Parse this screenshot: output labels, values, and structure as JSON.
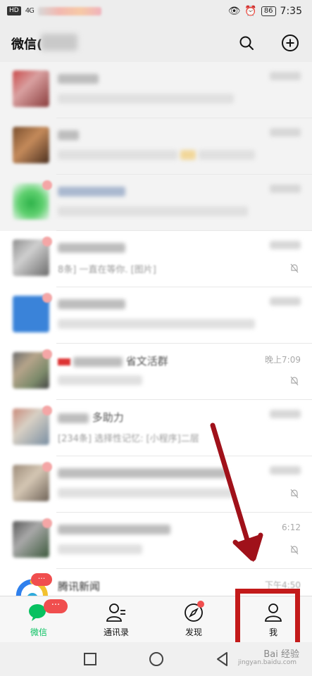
{
  "status_bar": {
    "chip": "HD",
    "signal": "4G",
    "battery": "86",
    "time": "7:35"
  },
  "header": {
    "title": "微信("
  },
  "chats": [
    {
      "msg": "",
      "time": "",
      "muted": false
    },
    {
      "msg": "",
      "time": "",
      "muted": false
    },
    {
      "msg": "",
      "time": "",
      "muted": false
    },
    {
      "msg": "8条] 一直在等你. [图片]",
      "time": "",
      "muted": true
    },
    {
      "msg": "",
      "time": "",
      "muted": false
    },
    {
      "name": "省文活群",
      "msg": "",
      "time": "晚上7:09",
      "muted": true
    },
    {
      "name": "多助力",
      "msg": "[234条] 选择性记忆: [小程序]二层",
      "time": "",
      "muted": false
    },
    {
      "msg": "",
      "time": "",
      "muted": true
    },
    {
      "msg": "",
      "time": "6:12",
      "muted": true
    },
    {
      "name": "腾讯新闻",
      "msg": "",
      "time": "下午4:50",
      "muted": false,
      "badge": "···"
    }
  ],
  "tabs": [
    {
      "label": "微信",
      "badge": "···"
    },
    {
      "label": "通讯录"
    },
    {
      "label": "发现"
    },
    {
      "label": "我"
    }
  ],
  "watermark": {
    "text": "Bai 经验",
    "sub": "jingyan.baidu.com"
  },
  "colors": {
    "accent": "#07c160",
    "badge": "#f04e4e",
    "annotation": "#c31a1a"
  }
}
